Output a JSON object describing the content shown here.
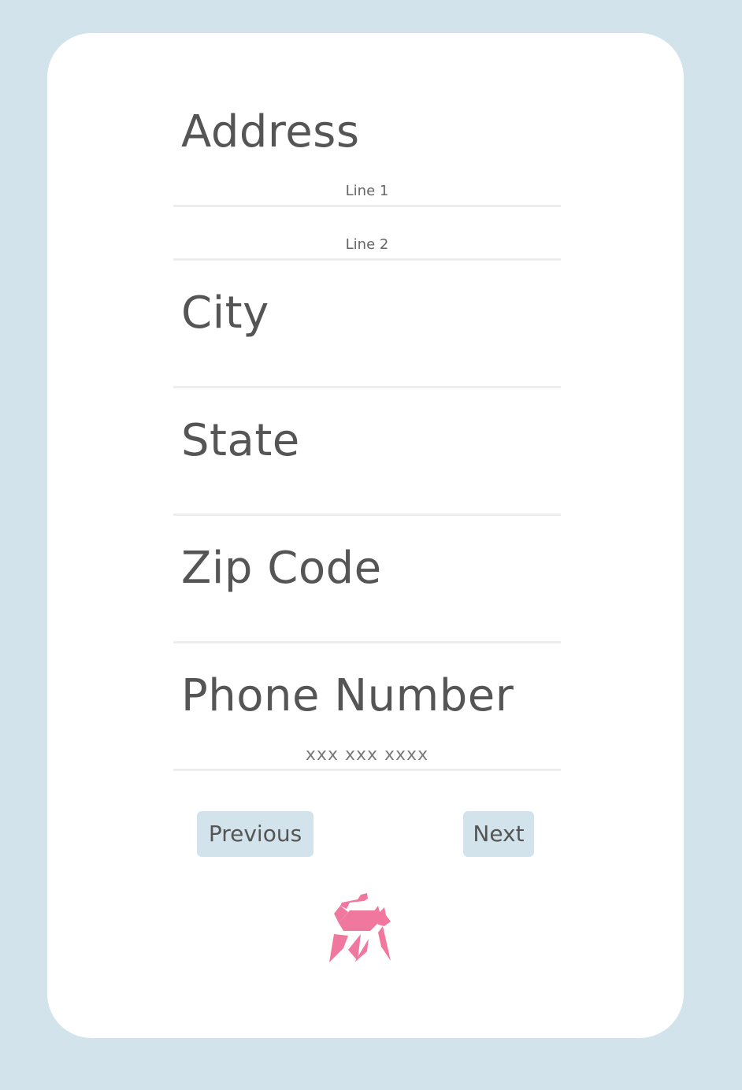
{
  "form": {
    "address": {
      "title": "Address",
      "line1_placeholder": "Line 1",
      "line2_placeholder": "Line 2"
    },
    "city": {
      "title": "City"
    },
    "state": {
      "title": "State"
    },
    "zip": {
      "title": "Zip Code"
    },
    "phone": {
      "title": "Phone Number",
      "placeholder": "xxx xxx  xxxx"
    }
  },
  "navigation": {
    "previous_label": "Previous",
    "next_label": "Next"
  },
  "logo": {
    "icon": "cat-logo-icon",
    "color": "#f0779e"
  },
  "colors": {
    "background": "#d2e3eb",
    "card": "#ffffff",
    "text": "#555555",
    "button": "#d2e3eb",
    "rule": "#eeeeee"
  }
}
